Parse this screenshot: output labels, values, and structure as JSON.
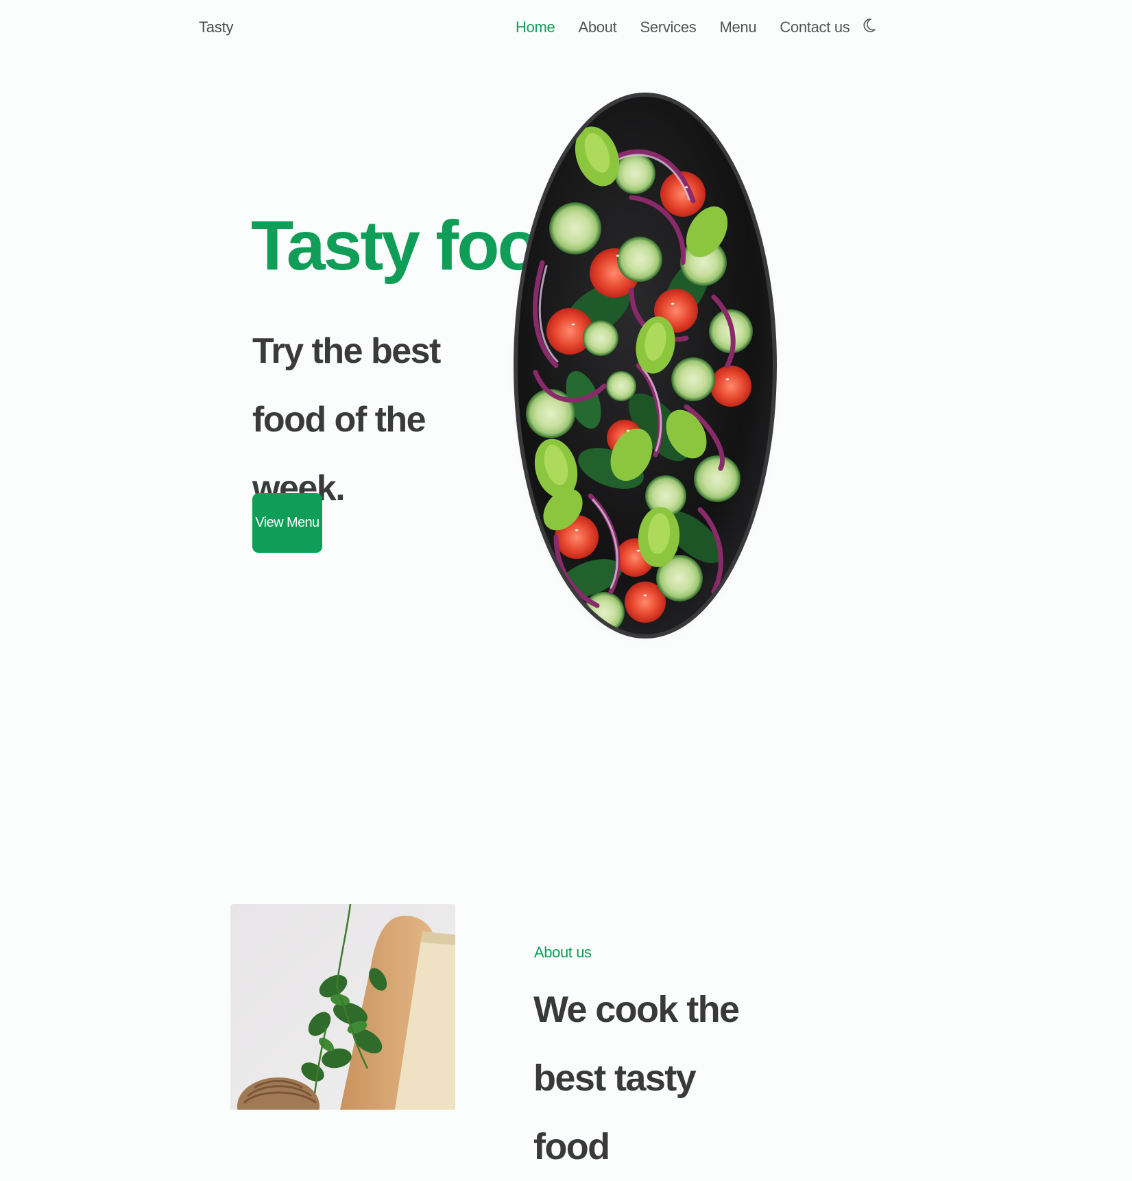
{
  "header": {
    "logo": "Tasty",
    "nav": [
      {
        "label": "Home",
        "active": true
      },
      {
        "label": "About",
        "active": false
      },
      {
        "label": "Services",
        "active": false
      },
      {
        "label": "Menu",
        "active": false
      },
      {
        "label": "Contact us",
        "active": false
      }
    ],
    "theme_toggle_icon": "moon-icon"
  },
  "hero": {
    "title": "Tasty food",
    "subtitle": "Try the best food of the week.",
    "button_label": "View Menu",
    "image": "salad-plate"
  },
  "about": {
    "kicker": "About us",
    "title": "We cook the best tasty food",
    "image": "herbs-and-bread"
  },
  "colors": {
    "accent": "#0f9d58",
    "text": "#393939",
    "background": "#fbfcfc"
  }
}
